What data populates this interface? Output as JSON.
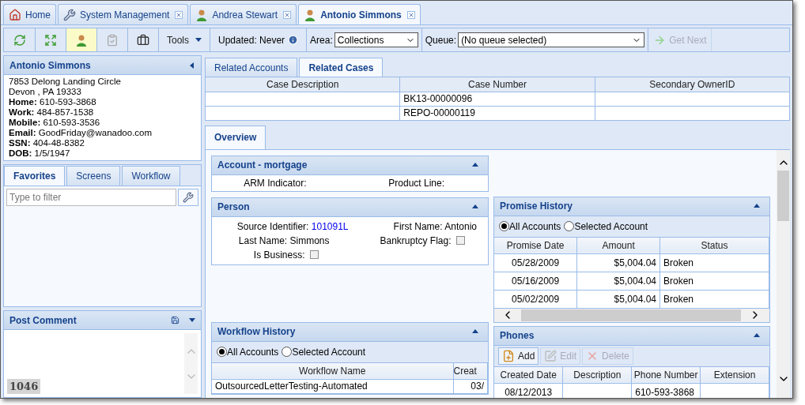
{
  "tabs": [
    {
      "label": "Home",
      "kind": "home",
      "closable": false,
      "selected": false
    },
    {
      "label": "System Management",
      "kind": "tool",
      "closable": true,
      "selected": false
    },
    {
      "label": "Andrea Stewart",
      "kind": "contact",
      "closable": true,
      "selected": false
    },
    {
      "label": "Antonio Simmons",
      "kind": "contact",
      "closable": true,
      "selected": true
    }
  ],
  "toolbar": {
    "tools": "Tools",
    "updated": "Updated: Never",
    "area": {
      "label": "Area:",
      "value": "Collections"
    },
    "queue": {
      "label": "Queue:",
      "value": "(No queue selected)"
    },
    "get_next": {
      "label": "Get Next",
      "disabled": true
    }
  },
  "profile": {
    "name": "Antonio Simmons",
    "address": [
      "7853 Delong Landing Circle",
      "Devon , PA 19333"
    ],
    "fields": [
      {
        "label": "Home:",
        "value": "610-593-3868"
      },
      {
        "label": "Work:",
        "value": "484-857-1538"
      },
      {
        "label": "Mobile:",
        "value": "610-593-3536"
      },
      {
        "label": "Email:",
        "value": "GoodFriday@wanadoo.com"
      },
      {
        "label": "SSN:",
        "value": "404-48-8382"
      },
      {
        "label": "DOB:",
        "value": "1/5/1947"
      }
    ]
  },
  "nav_tabs": [
    {
      "label": "Favorites",
      "selected": true
    },
    {
      "label": "Screens",
      "selected": false
    },
    {
      "label": "Workflow",
      "selected": false
    }
  ],
  "filter": {
    "placeholder": "Type to filter"
  },
  "post_comment": {
    "title": "Post Comment",
    "counter": "1046"
  },
  "related_tabs": [
    {
      "label": "Related Accounts",
      "selected": false
    },
    {
      "label": "Related Cases",
      "selected": true
    }
  ],
  "related_cases": {
    "columns": [
      "Case Description",
      "Case Number",
      "Secondary OwnerID"
    ],
    "rows": [
      {
        "case_number": "BK13-00000096"
      },
      {
        "case_number": "REPO-00000119"
      }
    ]
  },
  "overview_tab": {
    "label": "Overview",
    "selected": true
  },
  "account": {
    "title": "Account - mortgage",
    "fields": [
      "ARM Indicator:",
      "Product Line:"
    ]
  },
  "person": {
    "title": "Person",
    "source_identifier": {
      "label": "Source Identifier:",
      "value": "101091L"
    },
    "first_name": {
      "label": "First Name:",
      "value": "Antonio"
    },
    "last_name": {
      "label": "Last Name:",
      "value": "Simmons"
    },
    "bankruptcy_flag": {
      "label": "Bankruptcy Flag:",
      "checked": false
    },
    "is_business": {
      "label": "Is Business:",
      "checked": false
    }
  },
  "promise_history": {
    "title": "Promise History",
    "radios": [
      {
        "label": "All Accounts",
        "selected": true
      },
      {
        "label": "Selected Account",
        "selected": false
      }
    ],
    "columns": [
      "Promise Date",
      "Amount",
      "Status"
    ],
    "rows": [
      {
        "date": "05/28/2009",
        "amount": "$5,004.04",
        "status": "Broken"
      },
      {
        "date": "05/16/2009",
        "amount": "$5,004.04",
        "status": "Broken"
      },
      {
        "date": "05/02/2009",
        "amount": "$5,004.04",
        "status": "Broken"
      }
    ]
  },
  "workflow_history": {
    "title": "Workflow History",
    "radios": [
      {
        "label": "All Accounts",
        "selected": true
      },
      {
        "label": "Selected Account",
        "selected": false
      }
    ],
    "columns": [
      "Workflow Name",
      "Creat"
    ],
    "rows": [
      {
        "name": "OutsourcedLetterTesting-Automated",
        "created": "03/"
      }
    ]
  },
  "phones": {
    "title": "Phones",
    "buttons": [
      {
        "label": "Add",
        "kind": "add",
        "disabled": false
      },
      {
        "label": "Edit",
        "kind": "edit",
        "disabled": true
      },
      {
        "label": "Delete",
        "kind": "delete",
        "disabled": true
      }
    ],
    "columns": [
      "Created Date",
      "Description",
      "Phone Number",
      "Extension"
    ],
    "rows": [
      {
        "created": "08/12/2013",
        "phone_number": "610-593-3868"
      }
    ]
  }
}
